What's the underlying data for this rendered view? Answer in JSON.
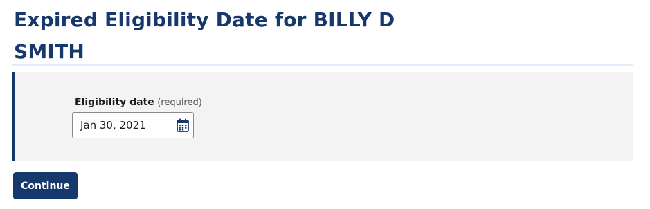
{
  "page": {
    "title": "Expired Eligibility Date for BILLY D SMITH"
  },
  "form": {
    "eligibility_date": {
      "label": "Eligibility date",
      "required_text": "(required)",
      "value": "Jan 30, 2021",
      "calendar_icon": "calendar-icon"
    }
  },
  "actions": {
    "continue_label": "Continue"
  },
  "colors": {
    "brand_navy": "#17386d",
    "panel_bg": "#f3f3f3",
    "title_rule": "#e3edf9"
  }
}
